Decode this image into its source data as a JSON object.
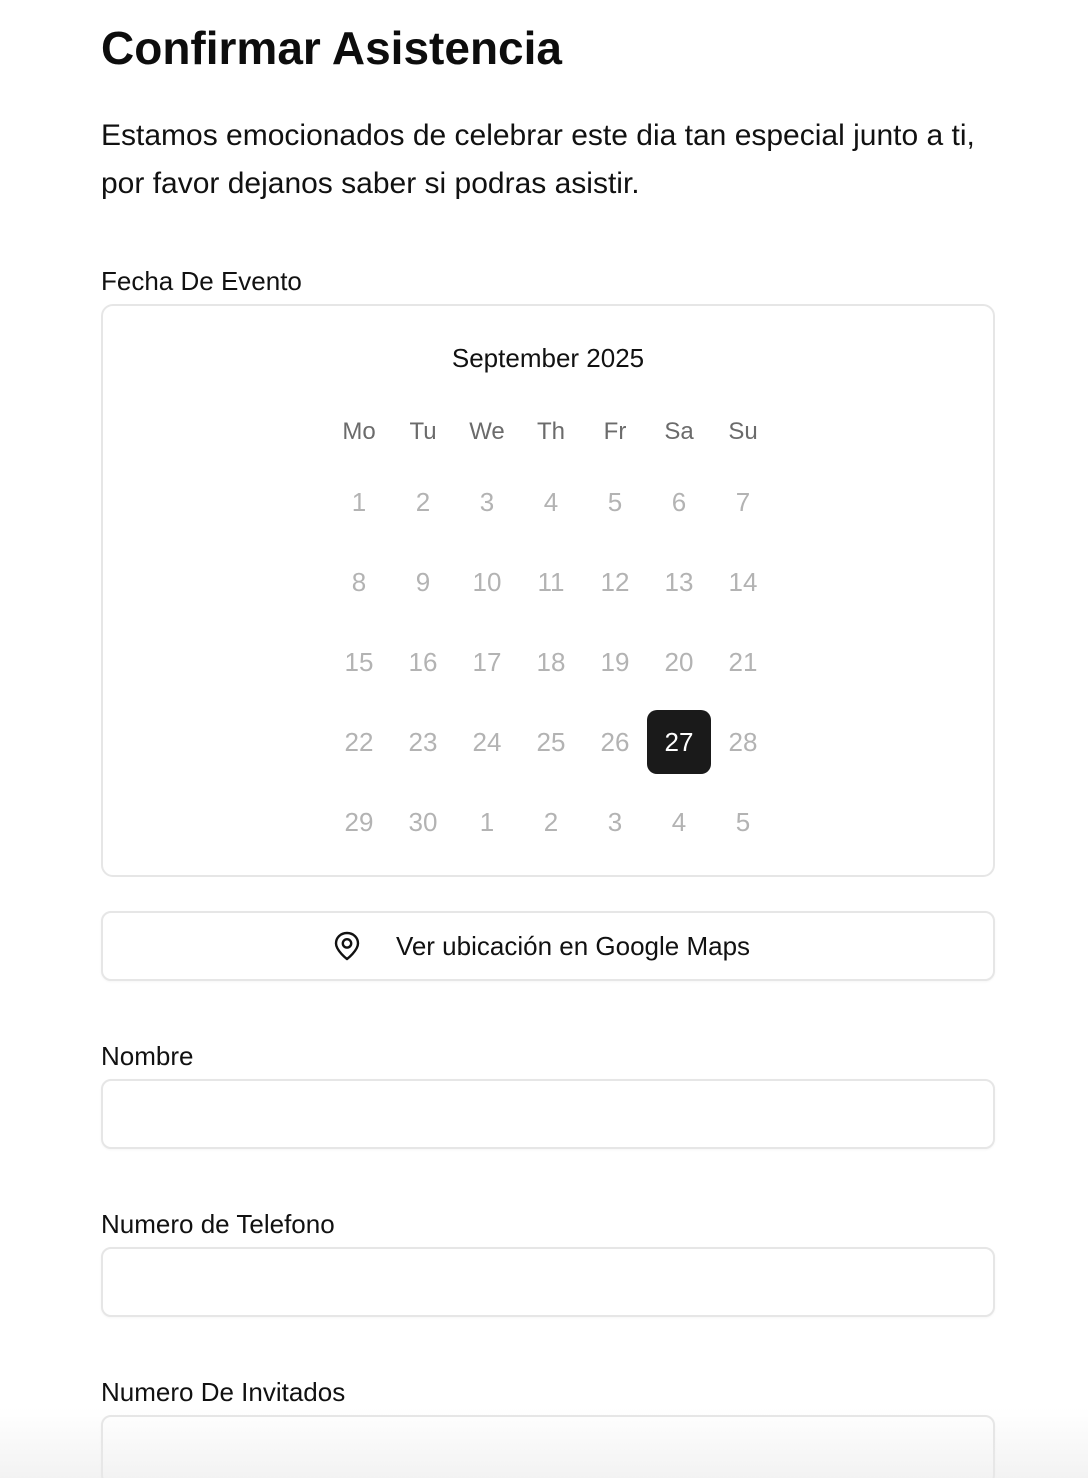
{
  "header": {
    "title": "Confirmar Asistencia",
    "intro": "Estamos emocionados de celebrar este dia tan especial junto a ti, por favor dejanos saber si podras asistir."
  },
  "event_date": {
    "label": "Fecha De Evento",
    "calendar": {
      "month_caption": "September 2025",
      "weekdays": [
        "Mo",
        "Tu",
        "We",
        "Th",
        "Fr",
        "Sa",
        "Su"
      ],
      "days": [
        "1",
        "2",
        "3",
        "4",
        "5",
        "6",
        "7",
        "8",
        "9",
        "10",
        "11",
        "12",
        "13",
        "14",
        "15",
        "16",
        "17",
        "18",
        "19",
        "20",
        "21",
        "22",
        "23",
        "24",
        "25",
        "26",
        "27",
        "28",
        "29",
        "30",
        "1",
        "2",
        "3",
        "4",
        "5"
      ],
      "selected_day": "27"
    }
  },
  "maps_button": {
    "icon": "map-pin-icon",
    "label": "Ver ubicación en Google Maps"
  },
  "form": {
    "name": {
      "label": "Nombre",
      "value": "",
      "placeholder": ""
    },
    "phone": {
      "label": "Numero de Telefono",
      "value": "",
      "placeholder": ""
    },
    "guests": {
      "label": "Numero De Invitados",
      "value": "",
      "placeholder": ""
    }
  },
  "colors": {
    "selected_day_bg": "#1a1a1a",
    "muted_day": "#b3b3b3",
    "weekday": "#6b6b6b",
    "border": "#e6e6e6"
  }
}
